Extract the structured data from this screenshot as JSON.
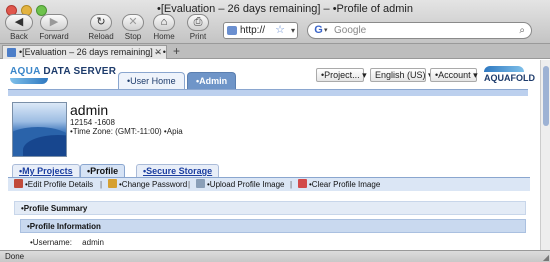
{
  "window": {
    "title": "•[Evaluation – 26 days remaining] – •Profile of admin"
  },
  "toolbar": {
    "back": "Back",
    "forward": "Forward",
    "reload": "Reload",
    "stop": "Stop",
    "home": "Home",
    "print": "Print",
    "url": "http://",
    "search_placeholder": "Google"
  },
  "tabs": [
    {
      "label": "•[Evaluation – 26 days remaining] – •Profile..."
    }
  ],
  "header": {
    "logo_aqua": "AQUA",
    "logo_rest": " DATA SERVER",
    "nav_user_home": "•User Home",
    "nav_admin": "•Admin",
    "project_select": "•Project...",
    "language_select": "English (US)",
    "account_select": "•Account",
    "logo_right": "AQUAFOLD"
  },
  "profile": {
    "name": "admin",
    "phone": "12154 -1608",
    "timezone": "•Time Zone: (GMT:-11:00) •Apia"
  },
  "profile_tabs": {
    "projects": "•My Projects",
    "profile": "•Profile",
    "storage": "•Secure Storage"
  },
  "actions": {
    "edit": "•Edit Profile Details",
    "password": "•Change Password",
    "upload": "•Upload Profile Image",
    "clear": "•Clear Profile Image",
    "separator": "|"
  },
  "sections": {
    "summary": "•Profile Summary",
    "info": "•Profile Information",
    "username_label": "•Username:",
    "username_value": "admin"
  },
  "status": {
    "text": "Done"
  },
  "colors": {
    "accent": "#3a86c9",
    "nav_bar": "#bcd0ee",
    "admin_tab": "#6f95c8"
  }
}
